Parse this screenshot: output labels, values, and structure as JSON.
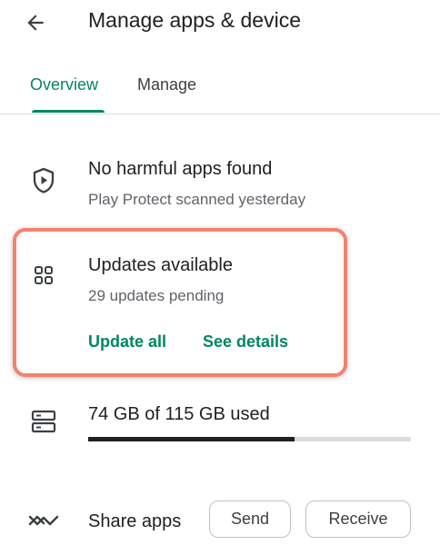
{
  "header": {
    "title": "Manage apps & device",
    "back_icon": "arrow-left-icon"
  },
  "tabs": [
    {
      "label": "Overview",
      "active": true
    },
    {
      "label": "Manage",
      "active": false
    }
  ],
  "protect": {
    "icon": "shield-play-icon",
    "title": "No harmful apps found",
    "subtitle": "Play Protect scanned yesterday"
  },
  "updates": {
    "icon": "apps-grid-icon",
    "title": "Updates available",
    "subtitle": "29 updates pending",
    "update_all_label": "Update all",
    "see_details_label": "See details",
    "highlight_color": "#f1836f"
  },
  "storage": {
    "icon": "storage-icon",
    "label": "74 GB of 115 GB used",
    "used_fraction": 0.64
  },
  "share": {
    "icon": "nearby-share-icon",
    "label": "Share apps",
    "send_label": "Send",
    "receive_label": "Receive"
  },
  "colors": {
    "accent": "#01875f",
    "text": "#202124",
    "secondary_text": "#5f6368"
  }
}
